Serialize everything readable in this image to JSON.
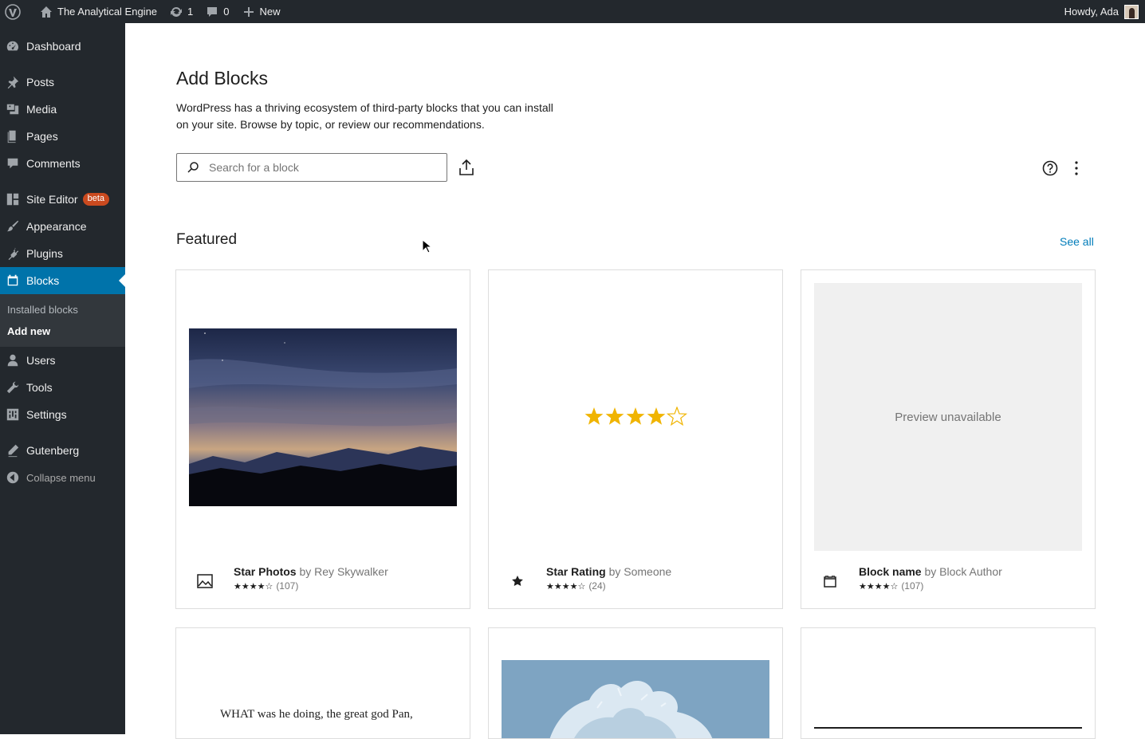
{
  "adminbar": {
    "site_name": "The Analytical Engine",
    "updates_count": "1",
    "comments_count": "0",
    "new_label": "New",
    "howdy": "Howdy, Ada"
  },
  "sidebar": {
    "items": [
      {
        "label": "Dashboard",
        "icon": "dashboard-icon"
      },
      {
        "label": "Posts",
        "icon": "pin-icon"
      },
      {
        "label": "Media",
        "icon": "media-icon"
      },
      {
        "label": "Pages",
        "icon": "pages-icon"
      },
      {
        "label": "Comments",
        "icon": "comment-icon"
      },
      {
        "label": "Site Editor",
        "icon": "layout-icon",
        "badge": "beta"
      },
      {
        "label": "Appearance",
        "icon": "brush-icon"
      },
      {
        "label": "Plugins",
        "icon": "plugin-icon"
      },
      {
        "label": "Blocks",
        "icon": "block-icon"
      },
      {
        "label": "Users",
        "icon": "user-icon"
      },
      {
        "label": "Tools",
        "icon": "wrench-icon"
      },
      {
        "label": "Settings",
        "icon": "settings-icon"
      },
      {
        "label": "Gutenberg",
        "icon": "pencil-icon"
      }
    ],
    "submenu": [
      "Installed blocks",
      "Add new"
    ],
    "collapse": "Collapse menu"
  },
  "main": {
    "title": "Add Blocks",
    "intro": "WordPress has a thriving ecosystem of third-party blocks that you can install on your site. Browse by topic, or review our recommendations.",
    "search_placeholder": "Search for a block",
    "featured_title": "Featured",
    "see_all": "See all",
    "cards": [
      {
        "name": "Star Photos",
        "author": "Rey Skywalker",
        "by": "by",
        "rating_text": "★★★★☆",
        "count": "(107)",
        "icon": "image-icon"
      },
      {
        "name": "Star Rating",
        "author": "Someone",
        "by": "by",
        "rating_text": "★★★★☆",
        "count": "(24)",
        "icon": "star-icon",
        "preview_stars": 4
      },
      {
        "name": "Block name",
        "author": "Block Author",
        "by": "by",
        "rating_text": "★★★★☆",
        "count": "(107)",
        "icon": "block-icon",
        "preview_text": "Preview unavailable"
      }
    ],
    "row2_poem": "WHAT was he doing, the great god Pan,"
  }
}
